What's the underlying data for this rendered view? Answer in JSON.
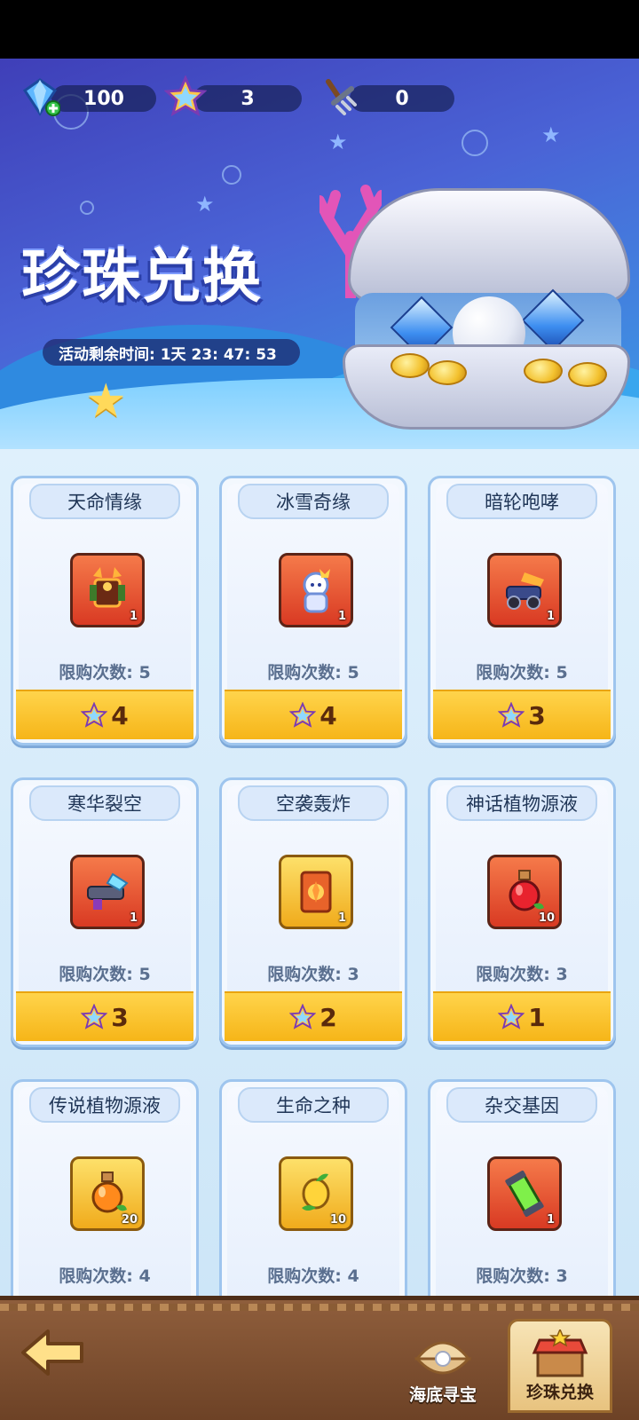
{
  "resources": [
    {
      "name": "diamond",
      "icon": "diamond-plus-icon",
      "value": "100"
    },
    {
      "name": "star-shell",
      "icon": "star-shell-icon",
      "value": "3"
    },
    {
      "name": "pickaxe",
      "icon": "rake-icon",
      "value": "0"
    }
  ],
  "banner": {
    "title": "珍珠兑换",
    "timer": "活动剩余时间: 1天 23: 47: 53"
  },
  "shop": {
    "items": [
      {
        "title": "天命情缘",
        "qty": "1",
        "limit": "限购次数: 5",
        "price": "4",
        "frame": "red",
        "icon": "red-mech-robot-icon"
      },
      {
        "title": "冰雪奇缘",
        "qty": "1",
        "limit": "限购次数: 5",
        "price": "4",
        "frame": "red",
        "icon": "ice-queen-icon"
      },
      {
        "title": "暗轮咆哮",
        "qty": "1",
        "limit": "限购次数: 5",
        "price": "3",
        "frame": "red",
        "icon": "dark-wheel-cannon-icon"
      },
      {
        "title": "寒华裂空",
        "qty": "1",
        "limit": "限购次数: 5",
        "price": "3",
        "frame": "red",
        "icon": "ice-blaster-icon"
      },
      {
        "title": "空袭轰炸",
        "qty": "1",
        "limit": "限购次数: 3",
        "price": "2",
        "frame": "gold",
        "icon": "air-raid-card-icon"
      },
      {
        "title": "神话植物源液",
        "qty": "10",
        "limit": "限购次数: 3",
        "price": "1",
        "frame": "red",
        "icon": "red-potion-icon"
      },
      {
        "title": "传说植物源液",
        "qty": "20",
        "limit": "限购次数: 4",
        "price": "",
        "frame": "gold",
        "icon": "orange-potion-icon"
      },
      {
        "title": "生命之种",
        "qty": "10",
        "limit": "限购次数: 4",
        "price": "",
        "frame": "gold",
        "icon": "life-seed-icon"
      },
      {
        "title": "杂交基因",
        "qty": "1",
        "limit": "限购次数: 3",
        "price": "",
        "frame": "red",
        "icon": "gene-tube-icon"
      }
    ]
  },
  "bottom_nav": {
    "back_icon": "back-arrow-icon",
    "tabs": [
      {
        "label": "海底寻宝",
        "icon": "clam-icon",
        "active": false
      },
      {
        "label": "珍珠兑换",
        "icon": "shop-stall-icon",
        "active": true
      }
    ]
  }
}
